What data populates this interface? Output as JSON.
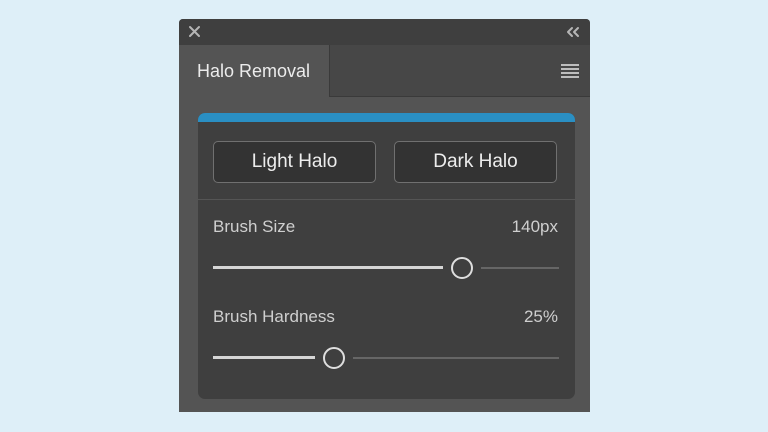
{
  "panel": {
    "close_icon": "close-icon",
    "collapse_icon": "double-chevron-left-icon",
    "menu_icon": "hamburger-menu-icon",
    "tab_label": "Halo Removal",
    "accent_color": "#2a8fc3"
  },
  "buttons": {
    "light_halo": "Light Halo",
    "dark_halo": "Dark Halo"
  },
  "sliders": [
    {
      "label": "Brush Size",
      "value": "140px",
      "fill_fraction": 0.72
    },
    {
      "label": "Brush Hardness",
      "value": "25%",
      "fill_fraction": 0.35
    }
  ]
}
